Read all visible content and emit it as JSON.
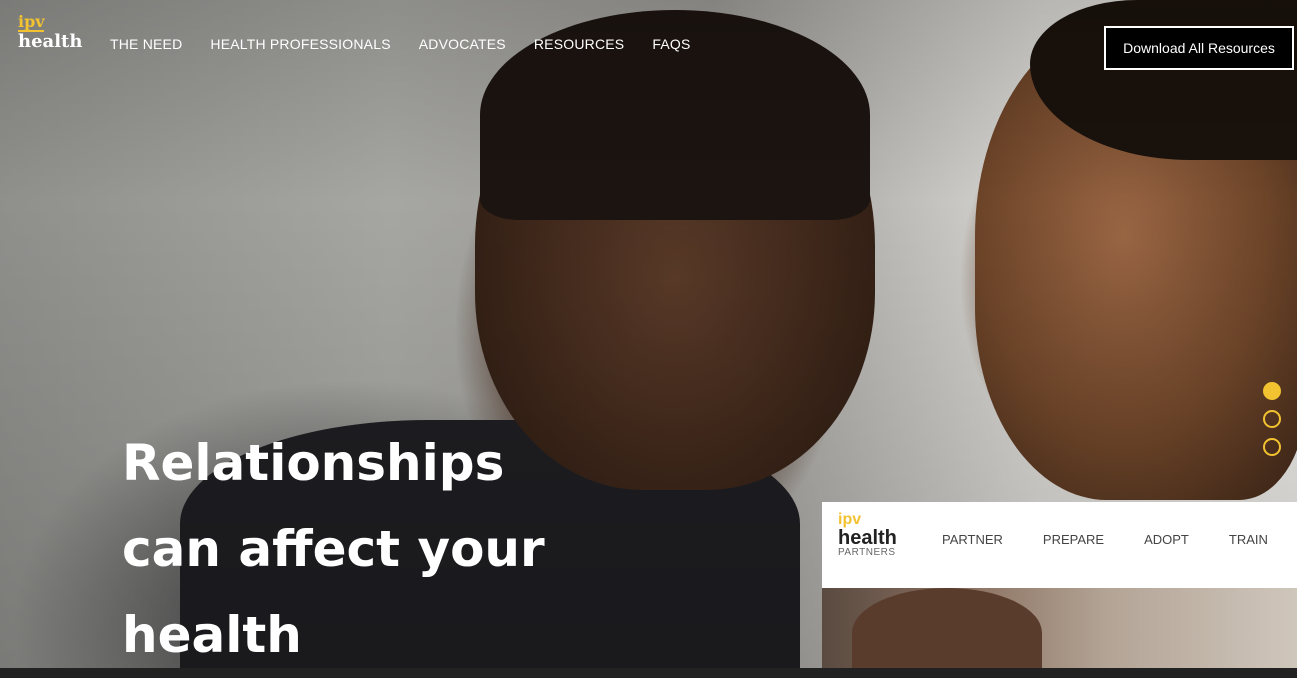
{
  "brand": {
    "ipv": "ipv",
    "health": "health",
    "accent": "#f2c230"
  },
  "nav": {
    "items": [
      "THE NEED",
      "HEALTH PROFESSIONALS",
      "ADVOCATES",
      "RESOURCES",
      "FAQS"
    ],
    "cta_label": "Download All Resources"
  },
  "hero": {
    "headline": [
      "Relationships",
      "can affect your",
      "health"
    ],
    "slides": {
      "count": 3,
      "active": 1
    }
  },
  "partners": {
    "logo": {
      "ipv": "ipv",
      "health": "health",
      "sub": "PARTNERS"
    },
    "menu": [
      "PARTNER",
      "PREPARE",
      "ADOPT",
      "TRAIN"
    ]
  }
}
